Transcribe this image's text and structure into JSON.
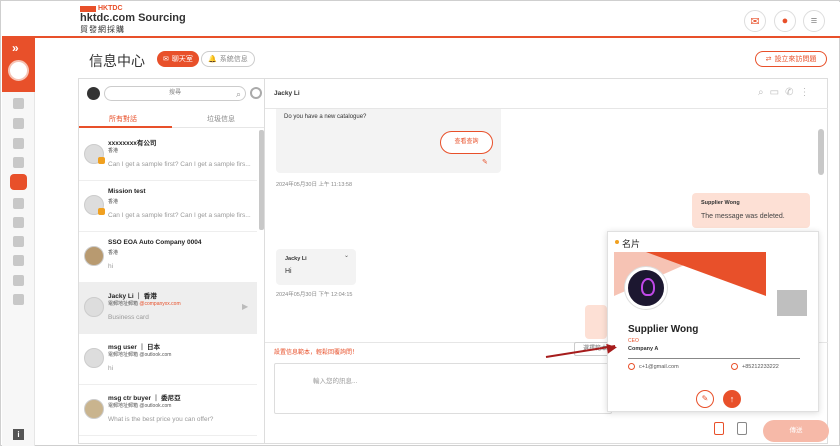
{
  "brand": {
    "tag": "HKTDC",
    "title": "hktdc.com Sourcing",
    "subtitle": "貿發網採購"
  },
  "header": {
    "icons": [
      "mail-icon",
      "bell-icon",
      "menu-icon"
    ]
  },
  "page": {
    "title": "信息中心",
    "chat_pill": "聊天室",
    "system_pill": "系統信息",
    "create_button": "設立來訪問題"
  },
  "search": {
    "placeholder": "搜尋"
  },
  "tabs": {
    "all": "所有對話",
    "spam": "垃圾信息"
  },
  "conversations": [
    {
      "name": "xxxxxxxx有公司",
      "sub": "香港",
      "msg": "Can I get a sample first? Can I get a sample firs..."
    },
    {
      "name": "Mission test",
      "sub": "香港",
      "msg": "Can I get a sample first? Can I get a sample firs..."
    },
    {
      "name": "SSO EOA Auto Company 0004",
      "sub": "香港",
      "msg": "hi"
    },
    {
      "name": "Jacky Li ｜ 香港",
      "sub": "電郵地址郵箱",
      "email": "@companyxx.com",
      "msg": "Business card"
    },
    {
      "name": "msg user ｜ 日本",
      "sub": "電郵地址郵箱",
      "email": "@outlook.com",
      "msg": "hi"
    },
    {
      "name": "msg ctr buyer ｜ 委尼亞",
      "sub": "電郵地址郵箱",
      "email": "@outlook.com",
      "msg": "What is the best price you can offer?"
    }
  ],
  "chat": {
    "contact": "Jacky Li",
    "msg1": "Do you have a new catalogue?",
    "msg1_button": "查看查詢",
    "ts1": "2024年05月30日 上午 11:13:58",
    "sender2": "Supplier Wong",
    "msg2": "The message was deleted.",
    "sender3": "Jacky Li",
    "msg3": "Hi",
    "ts2": "2024年05月30日 下午 12:04:15",
    "warning": "設置信息範本，輕鬆回覆詢問！",
    "template_button": "選擇範本",
    "input_placeholder": "輸入您的訊息...",
    "send_button": "傳送"
  },
  "card": {
    "title": "名片",
    "name": "Supplier Wong",
    "role": "CEO",
    "company": "Company A",
    "email": "c+1@gmail.com",
    "phone": "+85212233222"
  },
  "colors": {
    "accent": "#e8502a",
    "accent_light": "#fde0d5"
  }
}
